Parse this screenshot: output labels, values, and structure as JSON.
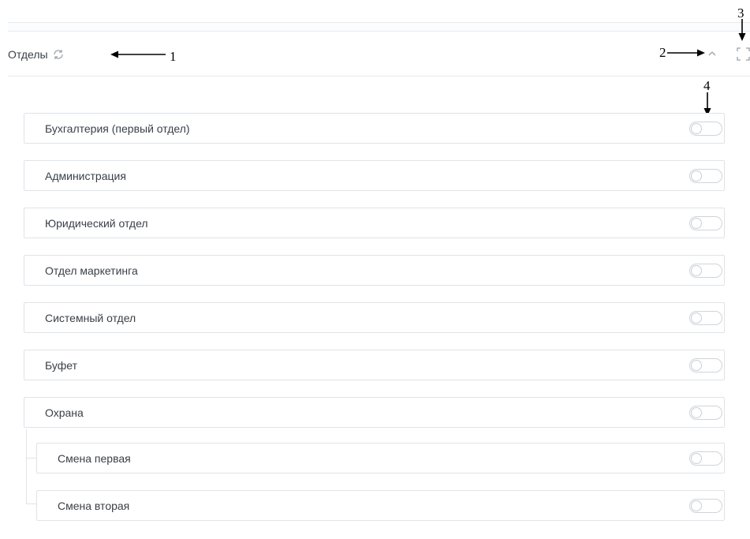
{
  "panel": {
    "title": "Отделы",
    "icons": {
      "refresh": "refresh-icon",
      "collapse": "chevron-up-icon",
      "fullscreen": "fullscreen-icon"
    }
  },
  "annotations": {
    "label_1": "1",
    "label_2": "2",
    "label_3": "3",
    "label_4": "4"
  },
  "departments": [
    {
      "label": "Бухгалтерия (первый отдел)",
      "enabled": false
    },
    {
      "label": "Администрация",
      "enabled": false
    },
    {
      "label": "Юридический отдел",
      "enabled": false
    },
    {
      "label": "Отдел маркетинга",
      "enabled": false
    },
    {
      "label": "Системный отдел",
      "enabled": false
    },
    {
      "label": "Буфет",
      "enabled": false
    },
    {
      "label": "Охрана",
      "enabled": false,
      "children": [
        {
          "label": "Смена первая",
          "enabled": false
        },
        {
          "label": "Смена вторая",
          "enabled": false
        }
      ]
    }
  ],
  "colors": {
    "border": "#dfe3e8",
    "text": "#3a3f47",
    "icon": "#9aa1ab"
  }
}
